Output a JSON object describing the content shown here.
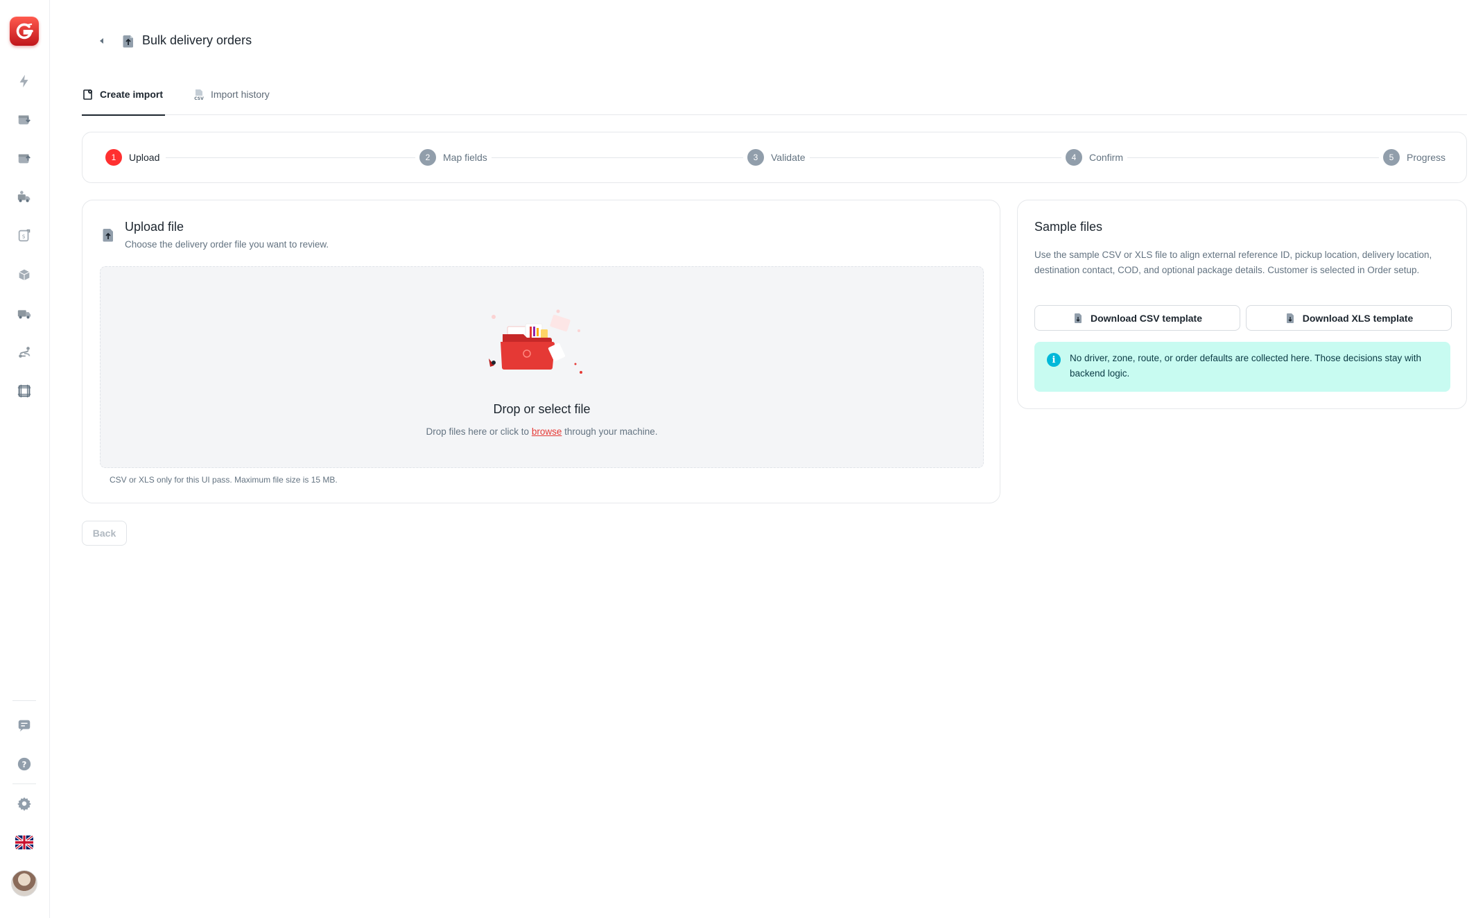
{
  "header": {
    "title": "Bulk delivery orders"
  },
  "tabs": [
    {
      "label": "Create import",
      "active": true
    },
    {
      "label": "Import history",
      "active": false
    }
  ],
  "stepper": {
    "steps": [
      {
        "number": "1",
        "label": "Upload",
        "active": true
      },
      {
        "number": "2",
        "label": "Map fields",
        "active": false
      },
      {
        "number": "3",
        "label": "Validate",
        "active": false
      },
      {
        "number": "4",
        "label": "Confirm",
        "active": false
      },
      {
        "number": "5",
        "label": "Progress",
        "active": false
      }
    ]
  },
  "upload": {
    "title": "Upload file",
    "subtitle": "Choose the delivery order file you want to review.",
    "drop_title": "Drop or select file",
    "drop_desc_before": "Drop files here or click to",
    "drop_desc_link": "browse",
    "drop_desc_after": "through your machine.",
    "helper": "CSV or XLS only for this UI pass. Maximum file size is 15 MB."
  },
  "sample": {
    "title": "Sample files",
    "description": "Use the sample CSV or XLS file to align external reference ID, pickup location, delivery location, destination contact, COD, and optional package details. Customer is selected in Order setup.",
    "csv_button": "Download CSV template",
    "xls_button": "Download XLS template",
    "alert": "No driver, zone, route, or order defaults are collected here. Those decisions stay with backend logic."
  },
  "footer": {
    "back_label": "Back"
  },
  "sidebar": {
    "icons": [
      "bolt-icon",
      "inbox-in-icon",
      "inbox-out-icon",
      "truck-user-icon",
      "invoice-icon",
      "packages-icon",
      "delivery-truck-icon",
      "route-icon",
      "frame-icon"
    ],
    "bottom_icons": [
      "chat-icon",
      "help-icon",
      "settings-icon"
    ]
  },
  "colors": {
    "brand": "#e53935",
    "active_step": "#ff3030",
    "inactive_step": "#919eab",
    "alert_bg": "#c8fbf1",
    "alert_icon": "#00b8d9"
  }
}
